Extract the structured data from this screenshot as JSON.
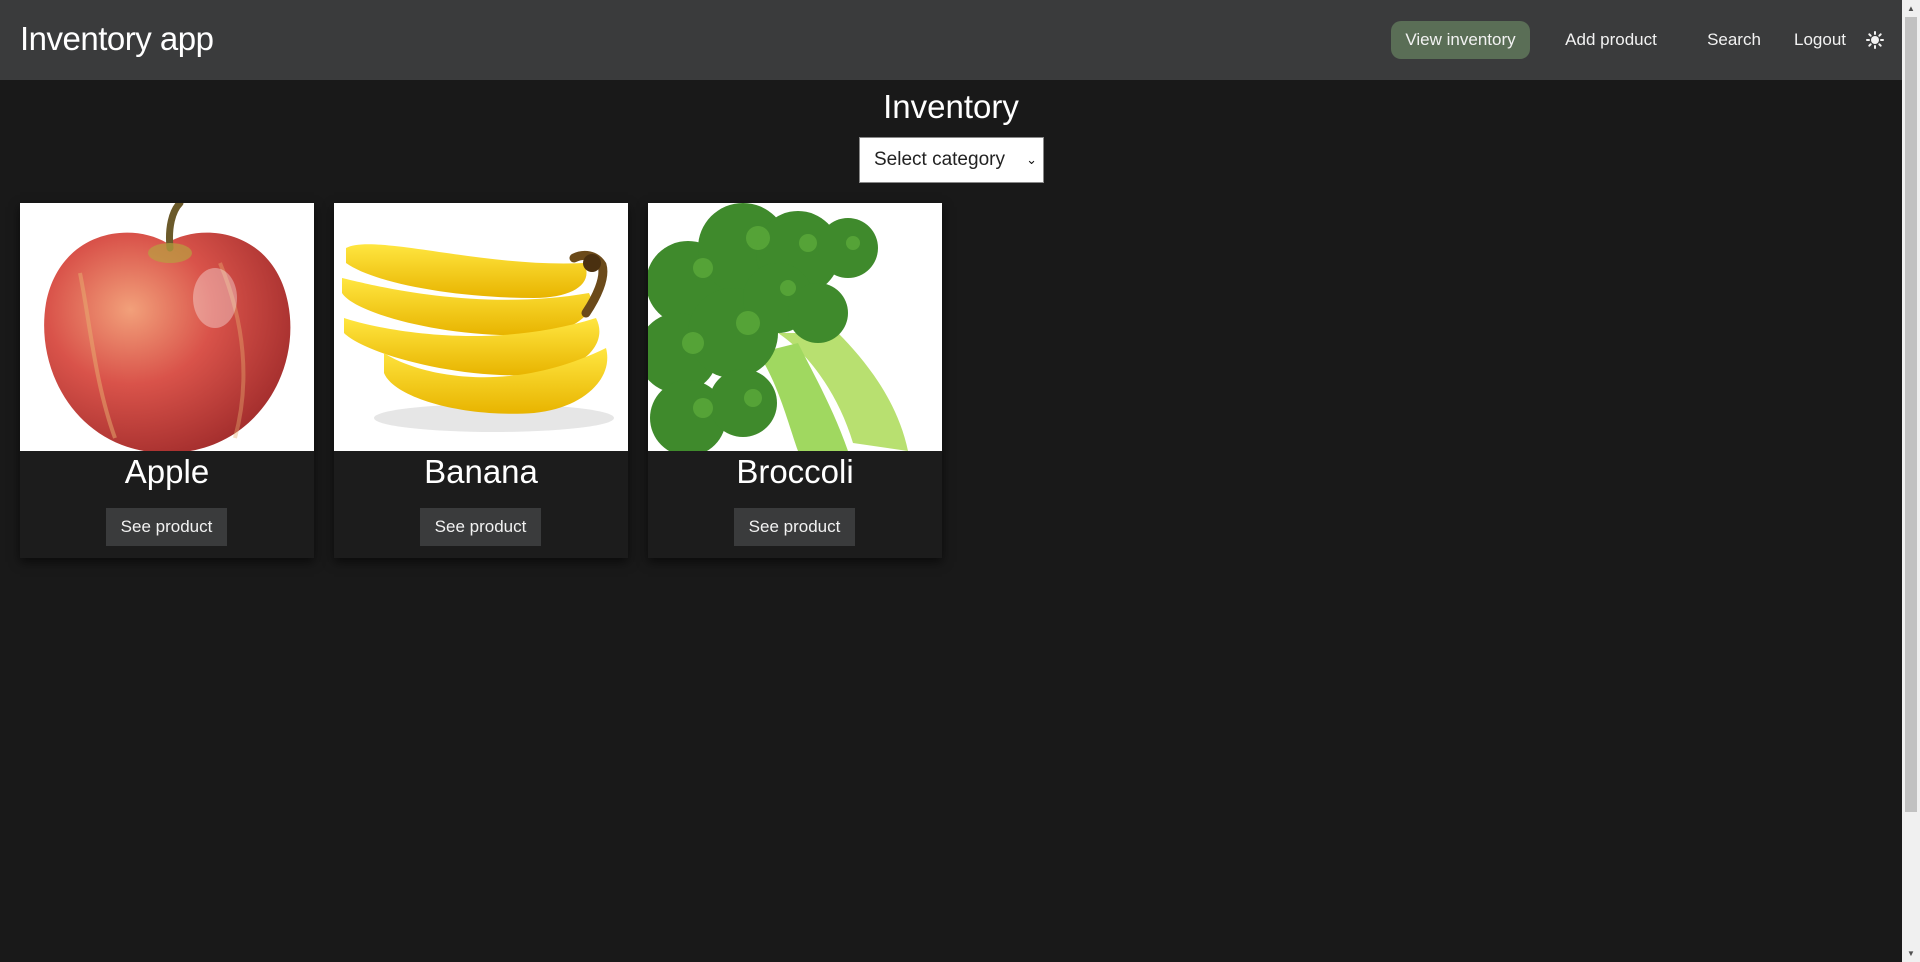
{
  "navbar": {
    "brand": "Inventory app",
    "links": [
      {
        "label": "View inventory",
        "active": true
      },
      {
        "label": "Add product"
      },
      {
        "label": "Search"
      },
      {
        "label": "Logout"
      }
    ],
    "theme_icon": "sun-icon",
    "active_color": "#5a6e56",
    "bg_color": "#3a3b3c"
  },
  "main": {
    "title": "Inventory",
    "category_select": {
      "selected": "Select category"
    }
  },
  "products": [
    {
      "name": "Apple",
      "button": "See product",
      "image_icon": "apple-image"
    },
    {
      "name": "Banana",
      "button": "See product",
      "image_icon": "banana-image"
    },
    {
      "name": "Broccoli",
      "button": "See product",
      "image_icon": "broccoli-image"
    }
  ],
  "colors": {
    "page_bg": "#191919"
  }
}
